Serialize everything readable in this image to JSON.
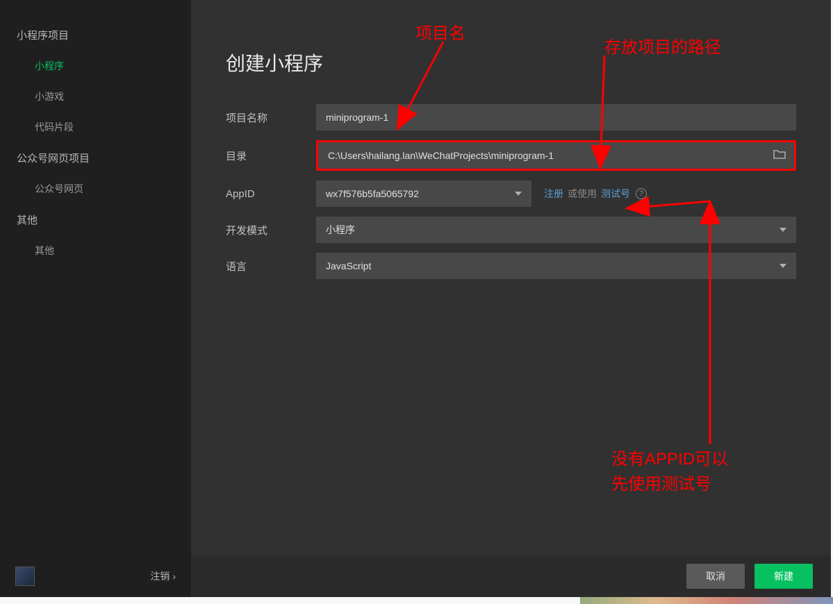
{
  "sidebar": {
    "sections": [
      {
        "title": "小程序项目",
        "items": [
          {
            "label": "小程序",
            "active": true
          },
          {
            "label": "小游戏",
            "active": false
          },
          {
            "label": "代码片段",
            "active": false
          }
        ]
      },
      {
        "title": "公众号网页项目",
        "items": [
          {
            "label": "公众号网页",
            "active": false
          }
        ]
      },
      {
        "title": "其他",
        "items": [
          {
            "label": "其他",
            "active": false
          }
        ]
      }
    ],
    "logout": "注销 ›"
  },
  "main": {
    "title": "创建小程序",
    "form": {
      "project_name_label": "项目名称",
      "project_name_value": "miniprogram-1",
      "directory_label": "目录",
      "directory_value": "C:\\Users\\hailang.lan\\WeChatProjects\\miniprogram-1",
      "appid_label": "AppID",
      "appid_value": "wx7f576b5fa5065792",
      "register_link": "注册",
      "or_use_text": "或使用",
      "test_account_link": "测试号",
      "dev_mode_label": "开发模式",
      "dev_mode_value": "小程序",
      "language_label": "语言",
      "language_value": "JavaScript"
    },
    "buttons": {
      "cancel": "取消",
      "create": "新建"
    }
  },
  "annotations": {
    "project_name": "项目名",
    "directory_path": "存放项目的路径",
    "appid_tip": "没有APPID可以\n先使用测试号"
  }
}
